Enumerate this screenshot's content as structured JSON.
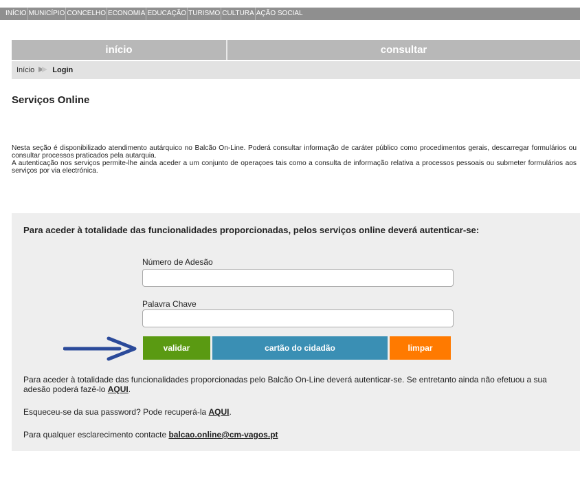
{
  "topnav": [
    "INÍCIO",
    "MUNICÍPIO",
    "CONCELHO",
    "ECONOMIA",
    "EDUCAÇÃO",
    "TURISMO",
    "CULTURA",
    "AÇÃO SOCIAL"
  ],
  "mainnav": {
    "inicio": "início",
    "consultar": "consultar"
  },
  "breadcrumb": {
    "home": "Início",
    "current": "Login"
  },
  "page_title": "Serviços Online",
  "intro": {
    "line1": "Nesta seção é disponibilizado atendimento autárquico no Balcão On-Line. Poderá consultar informação de caráter público como procedimentos gerais, descarregar formulários ou consultar processos praticados pela autarquia.",
    "line2": "A autenticação nos serviços permite-lhe ainda aceder a um conjunto de operaçoes tais como a consulta de informação relativa a processos pessoais ou submeter formulários aos serviços por via electrónica."
  },
  "login": {
    "heading": "Para aceder à totalidade das funcionalidades proporcionadas, pelos serviços online deverá autenticar-se:",
    "adesao_label": "Número de Adesão",
    "adesao_value": "",
    "password_label": "Palavra Chave",
    "password_value": "",
    "buttons": {
      "validar": "validar",
      "cartao": "cartão do cidadão",
      "limpar": "limpar"
    }
  },
  "info": {
    "p1_text": "Para aceder à totalidade das funcionalidades proporcionadas pelo Balcão On-Line deverá autenticar-se. Se entretanto ainda não efetuou a sua adesão poderá fazê-lo ",
    "p1_link": "AQUI",
    "p2_text": "Esqueceu-se da sua password? Pode recuperá-la ",
    "p2_link": "AQUI",
    "p3_text": "Para qualquer esclarecimento contacte ",
    "p3_link": "balcao.online@cm-vagos.pt"
  },
  "colors": {
    "arrow": "#2b4a9a",
    "validar": "#5a9a12",
    "cartao": "#3a8fb4",
    "limpar": "#ff7a00"
  }
}
